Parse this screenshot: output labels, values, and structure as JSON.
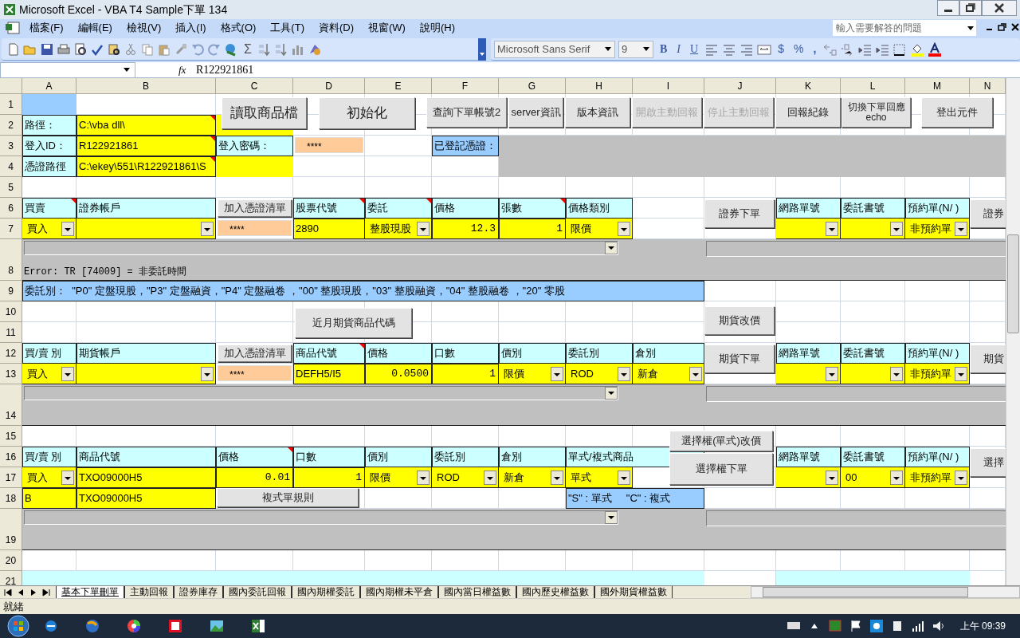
{
  "window": {
    "title": "Microsoft Excel - VBA T4 Sample下單 134"
  },
  "menu": [
    "檔案(F)",
    "編輯(E)",
    "檢視(V)",
    "插入(I)",
    "格式(O)",
    "工具(T)",
    "資料(D)",
    "視窗(W)",
    "說明(H)"
  ],
  "help_box": {
    "placeholder": "輸入需要解答的問題"
  },
  "format_toolbar": {
    "font": "Microsoft Sans Serif",
    "size": "9",
    "buttons": [
      "B",
      "I",
      "U",
      "$",
      "%",
      ","
    ]
  },
  "standard_toolbar": {
    "sum": "Σ"
  },
  "formula_bar": {
    "fx": "fx",
    "value": "R122921861"
  },
  "columns": [
    "A",
    "B",
    "C",
    "D",
    "E",
    "F",
    "G",
    "H",
    "I",
    "J",
    "K",
    "L",
    "M",
    "N"
  ],
  "rows": [
    {
      "number": "1",
      "cells": [
        {
          "kind": "fill",
          "color": "#99ccff"
        }
      ]
    },
    {
      "number": "2",
      "cells": [
        {
          "kind": "label",
          "text": "路徑：",
          "color": "#ccffff"
        },
        {
          "kind": "text",
          "text": "C:\\vba dll\\",
          "color": "#ffff00",
          "comment": true
        },
        {
          "kind": "fill",
          "color": "#ffff00"
        }
      ]
    },
    {
      "number": "3",
      "cells": [
        {
          "kind": "label",
          "text": "登入ID：",
          "color": "#ccffff"
        },
        {
          "kind": "text",
          "text": "R122921861",
          "color": "#ffff00",
          "comment": true
        },
        {
          "kind": "label",
          "text": "登入密碼：",
          "color": "#ccffff"
        },
        {
          "kind": "password",
          "text": "****",
          "color": "#ffcc99"
        },
        {
          "kind": "empty"
        },
        {
          "kind": "label",
          "text": "已登記憑證：",
          "color": "#99ccff"
        },
        {
          "kind": "fill",
          "color": "#c0c0c0"
        },
        {
          "kind": "merged"
        },
        {
          "kind": "merged"
        },
        {
          "kind": "merged"
        },
        {
          "kind": "merged"
        },
        {
          "kind": "merged"
        },
        {
          "kind": "merged"
        },
        {
          "kind": "merged"
        }
      ]
    },
    {
      "number": "4",
      "cells": [
        {
          "kind": "label",
          "text": "憑證路徑",
          "color": "#ccffff"
        },
        {
          "kind": "text",
          "text": "C:\\ekey\\551\\R122921861\\S",
          "color": "#ffff00",
          "comment": true
        },
        {
          "kind": "fill",
          "color": "#ffff00"
        },
        {
          "kind": "empty"
        },
        {
          "kind": "empty"
        },
        {
          "kind": "empty"
        },
        {
          "kind": "fill",
          "color": "#c0c0c0"
        },
        {
          "kind": "merged"
        },
        {
          "kind": "merged"
        },
        {
          "kind": "merged"
        },
        {
          "kind": "merged"
        },
        {
          "kind": "merged"
        },
        {
          "kind": "merged"
        },
        {
          "kind": "merged"
        }
      ]
    },
    {
      "number": "5"
    },
    {
      "number": "6",
      "cells": [
        {
          "kind": "label",
          "text": "買賣",
          "color": "#ccffff",
          "comment": true
        },
        {
          "kind": "label",
          "text": "證券帳戶",
          "color": "#ccffff"
        },
        {
          "kind": "empty"
        },
        {
          "kind": "label",
          "text": "股票代號",
          "color": "#ccffff",
          "comment": true
        },
        {
          "kind": "label",
          "text": "委託",
          "color": "#ccffff",
          "comment": true
        },
        {
          "kind": "label",
          "text": "價格",
          "color": "#ccffff"
        },
        {
          "kind": "label",
          "text": "張數",
          "color": "#ccffff",
          "comment": true
        },
        {
          "kind": "label",
          "text": "價格類別",
          "color": "#ccffff"
        },
        {
          "kind": "empty"
        },
        {
          "kind": "empty"
        },
        {
          "kind": "label",
          "text": "網路單號",
          "color": "#ccffff"
        },
        {
          "kind": "label",
          "text": "委託書號",
          "color": "#ccffff"
        },
        {
          "kind": "label",
          "text": "預約單(N/ )",
          "color": "#ccffff"
        }
      ]
    },
    {
      "number": "7",
      "cells": [
        {
          "kind": "combo",
          "text": "買入",
          "color": "#ffff00"
        },
        {
          "kind": "combo",
          "color": "#ffff00"
        },
        {
          "kind": "password",
          "text": "****",
          "color": "#ffcc99"
        },
        {
          "kind": "text",
          "text": "2890",
          "color": "#ffff00"
        },
        {
          "kind": "combo",
          "text": "整股現股",
          "color": "#ffff00"
        },
        {
          "kind": "number",
          "text": "12.3",
          "color": "#ffff00"
        },
        {
          "kind": "number",
          "text": "1",
          "color": "#ffff00"
        },
        {
          "kind": "combo",
          "text": "限價",
          "color": "#ffff00"
        },
        {
          "kind": "empty"
        },
        {
          "kind": "empty"
        },
        {
          "kind": "combo",
          "color": "#ffff00"
        },
        {
          "kind": "combo",
          "color": "#ffff00"
        },
        {
          "kind": "combo",
          "text": "非預約單",
          "color": "#ffff00"
        }
      ]
    },
    {
      "number": "8",
      "cells": [
        {
          "kind": "band",
          "text": "Error: TR [74009] = 非委託時間",
          "color": "#c0c0c0"
        },
        {
          "kind": "merged"
        },
        {
          "kind": "merged"
        },
        {
          "kind": "merged"
        },
        {
          "kind": "merged"
        },
        {
          "kind": "merged"
        },
        {
          "kind": "merged"
        },
        {
          "kind": "merged"
        },
        {
          "kind": "merged"
        },
        {
          "kind": "merged"
        },
        {
          "kind": "merged"
        },
        {
          "kind": "merged"
        },
        {
          "kind": "merged"
        },
        {
          "kind": "merged"
        }
      ]
    },
    {
      "number": "9",
      "cells": [
        {
          "kind": "label",
          "text": "委託別：  \"P0\" 定盤現股，\"P3\" 定盤融資，\"P4\" 定盤融卷 ，\"00\" 整股現股，\"03\" 整股融資，\"04\" 整股融卷 ，\"20\" 零股",
          "color": "#99ccff"
        },
        {
          "kind": "merged"
        },
        {
          "kind": "merged"
        },
        {
          "kind": "merged"
        },
        {
          "kind": "merged"
        },
        {
          "kind": "merged"
        },
        {
          "kind": "merged"
        },
        {
          "kind": "merged"
        },
        {
          "kind": "merged"
        }
      ]
    },
    {
      "number": "10"
    },
    {
      "number": "11"
    },
    {
      "number": "12",
      "cells": [
        {
          "kind": "label",
          "text": "買/賣 別",
          "color": "#ccffff"
        },
        {
          "kind": "label",
          "text": "期貨帳戶",
          "color": "#ccffff"
        },
        {
          "kind": "empty"
        },
        {
          "kind": "label",
          "text": "商品代號",
          "color": "#ccffff",
          "comment": true
        },
        {
          "kind": "label",
          "text": "價格",
          "color": "#ccffff"
        },
        {
          "kind": "label",
          "text": "口數",
          "color": "#ccffff"
        },
        {
          "kind": "label",
          "text": "價別",
          "color": "#ccffff"
        },
        {
          "kind": "label",
          "text": "委託別",
          "color": "#ccffff"
        },
        {
          "kind": "label",
          "text": "倉別",
          "color": "#ccffff"
        },
        {
          "kind": "empty"
        },
        {
          "kind": "label",
          "text": "網路單號",
          "color": "#ccffff"
        },
        {
          "kind": "label",
          "text": "委託書號",
          "color": "#ccffff"
        },
        {
          "kind": "label",
          "text": "預約單(N/ )",
          "color": "#ccffff"
        }
      ]
    },
    {
      "number": "13",
      "cells": [
        {
          "kind": "combo",
          "text": "買入",
          "color": "#ffff00"
        },
        {
          "kind": "combo",
          "color": "#ffff00"
        },
        {
          "kind": "password",
          "text": "****",
          "color": "#ffcc99"
        },
        {
          "kind": "text",
          "text": "DEFH5/I5",
          "color": "#ffff00"
        },
        {
          "kind": "number",
          "text": "0.0500",
          "color": "#ffff00"
        },
        {
          "kind": "number",
          "text": "1",
          "color": "#ffff00"
        },
        {
          "kind": "combo",
          "text": "限價",
          "color": "#ffff00"
        },
        {
          "kind": "combo",
          "text": "ROD",
          "color": "#ffff00"
        },
        {
          "kind": "combo",
          "text": "新倉",
          "color": "#ffff00"
        },
        {
          "kind": "empty"
        },
        {
          "kind": "combo",
          "color": "#ffff00"
        },
        {
          "kind": "combo",
          "color": "#ffff00"
        },
        {
          "kind": "combo",
          "text": "非預約單",
          "color": "#ffff00"
        }
      ]
    },
    {
      "number": "14",
      "cells": [
        {
          "kind": "band",
          "color": "#c0c0c0"
        },
        {
          "kind": "merged"
        },
        {
          "kind": "merged"
        },
        {
          "kind": "merged"
        },
        {
          "kind": "merged"
        },
        {
          "kind": "merged"
        },
        {
          "kind": "merged"
        },
        {
          "kind": "merged"
        },
        {
          "kind": "merged"
        },
        {
          "kind": "merged"
        },
        {
          "kind": "merged"
        },
        {
          "kind": "merged"
        },
        {
          "kind": "merged"
        },
        {
          "kind": "merged"
        }
      ]
    },
    {
      "number": "15"
    },
    {
      "number": "16",
      "cells": [
        {
          "kind": "label",
          "text": "買/賣 別",
          "color": "#ccffff"
        },
        {
          "kind": "label",
          "text": "商品代號",
          "color": "#ccffff"
        },
        {
          "kind": "label",
          "text": "價格",
          "color": "#ccffff",
          "comment": true
        },
        {
          "kind": "label",
          "text": "口數",
          "color": "#ccffff"
        },
        {
          "kind": "label",
          "text": "價別",
          "color": "#ccffff"
        },
        {
          "kind": "label",
          "text": "委託別",
          "color": "#ccffff"
        },
        {
          "kind": "label",
          "text": "倉別",
          "color": "#ccffff"
        },
        {
          "kind": "label",
          "text": "單式/複式商品",
          "color": "#ccffff"
        },
        {
          "kind": "merged"
        },
        {
          "kind": "empty"
        },
        {
          "kind": "label",
          "text": "網路單號",
          "color": "#ccffff"
        },
        {
          "kind": "label",
          "text": "委託書號",
          "color": "#ccffff"
        },
        {
          "kind": "label",
          "text": "預約單(N/ )",
          "color": "#ccffff"
        }
      ]
    },
    {
      "number": "17",
      "cells": [
        {
          "kind": "combo",
          "text": "買入",
          "color": "#ffff00"
        },
        {
          "kind": "text",
          "text": "TXO09000H5",
          "color": "#ffff00"
        },
        {
          "kind": "number",
          "text": "0.01",
          "color": "#ffff00"
        },
        {
          "kind": "number",
          "text": "1",
          "color": "#ffff00"
        },
        {
          "kind": "combo",
          "text": "限價",
          "color": "#ffff00"
        },
        {
          "kind": "combo",
          "text": "ROD",
          "color": "#ffff00"
        },
        {
          "kind": "combo",
          "text": "新倉",
          "color": "#ffff00"
        },
        {
          "kind": "combo",
          "text": "單式",
          "color": "#ffff00"
        },
        {
          "kind": "empty"
        },
        {
          "kind": "empty"
        },
        {
          "kind": "combo",
          "color": "#ffff00"
        },
        {
          "kind": "combo",
          "text": "00",
          "color": "#ffff00"
        },
        {
          "kind": "combo",
          "text": "非預約單",
          "color": "#ffff00"
        }
      ]
    },
    {
      "number": "18",
      "cells": [
        {
          "kind": "text",
          "text": "B",
          "color": "#ffff00"
        },
        {
          "kind": "text",
          "text": "TXO09000H5",
          "color": "#ffff00"
        },
        {
          "kind": "empty"
        },
        {
          "kind": "empty"
        },
        {
          "kind": "empty"
        },
        {
          "kind": "empty"
        },
        {
          "kind": "empty"
        },
        {
          "kind": "label",
          "text": "\"S\" : 單式     \"C\" : 複式",
          "color": "#99ccff"
        },
        {
          "kind": "merged"
        }
      ]
    },
    {
      "number": "19",
      "cells": [
        {
          "kind": "band",
          "color": "#c0c0c0"
        },
        {
          "kind": "merged"
        },
        {
          "kind": "merged"
        },
        {
          "kind": "merged"
        },
        {
          "kind": "merged"
        },
        {
          "kind": "merged"
        },
        {
          "kind": "merged"
        },
        {
          "kind": "merged"
        },
        {
          "kind": "merged"
        },
        {
          "kind": "merged"
        },
        {
          "kind": "merged"
        },
        {
          "kind": "merged"
        },
        {
          "kind": "merged"
        },
        {
          "kind": "merged"
        }
      ]
    },
    {
      "number": "20"
    },
    {
      "number": "21",
      "cells": [
        {
          "kind": "fill",
          "color": "#ccffff"
        },
        {
          "kind": "merged"
        },
        {
          "kind": "merged"
        },
        {
          "kind": "merged"
        },
        {
          "kind": "merged"
        },
        {
          "kind": "merged"
        },
        {
          "kind": "merged"
        },
        {
          "kind": "merged"
        },
        {
          "kind": "merged"
        },
        {
          "kind": "empty"
        },
        {
          "kind": "fill",
          "color": "#ccffff"
        },
        {
          "kind": "merged"
        },
        {
          "kind": "merged"
        }
      ]
    }
  ],
  "buttons": [
    {
      "label": "讀取商品檔",
      "disabled": false
    },
    {
      "label": "初始化",
      "disabled": false
    },
    {
      "label": "查詢下單帳號2",
      "disabled": false
    },
    {
      "label": "server資訊",
      "disabled": false
    },
    {
      "label": "版本資訊",
      "disabled": false
    },
    {
      "label": "開啟主動回報",
      "disabled": true
    },
    {
      "label": "停止主動回報",
      "disabled": true
    },
    {
      "label": "回報紀錄",
      "disabled": false
    },
    {
      "label": "切換下單回應\necho",
      "disabled": false
    },
    {
      "label": "登出元件",
      "disabled": false
    },
    {
      "label": "加入憑證清單",
      "disabled": false
    },
    {
      "label": "證券下單",
      "disabled": false
    },
    {
      "label": "證券",
      "disabled": false
    },
    {
      "label": "近月期貨商品代碼",
      "disabled": false
    },
    {
      "label": "期貨改價",
      "disabled": false
    },
    {
      "label": "加入憑證清單",
      "disabled": false
    },
    {
      "label": "期貨下單",
      "disabled": false
    },
    {
      "label": "期貨",
      "disabled": false
    },
    {
      "label": "選擇權(單式)改價",
      "disabled": false
    },
    {
      "label": "選擇權下單",
      "disabled": false
    },
    {
      "label": "選擇",
      "disabled": false
    },
    {
      "label": "複式單規則",
      "disabled": false
    }
  ],
  "sheet_tabs": [
    {
      "label": "基本下單刪單",
      "selected": true
    },
    {
      "label": "主動回報",
      "selected": false
    },
    {
      "label": "證券庫存",
      "selected": false
    },
    {
      "label": "國內委託回報",
      "selected": false
    },
    {
      "label": "國內期權委託",
      "selected": false
    },
    {
      "label": "國內期權未平倉",
      "selected": false
    },
    {
      "label": "國內當日權益數",
      "selected": false
    },
    {
      "label": "國內歷史權益數",
      "selected": false
    },
    {
      "label": "國外期貨權益數",
      "selected": false
    }
  ],
  "status_bar": {
    "text": "就緒"
  },
  "taskbar": {
    "time": "上午 09:39"
  }
}
